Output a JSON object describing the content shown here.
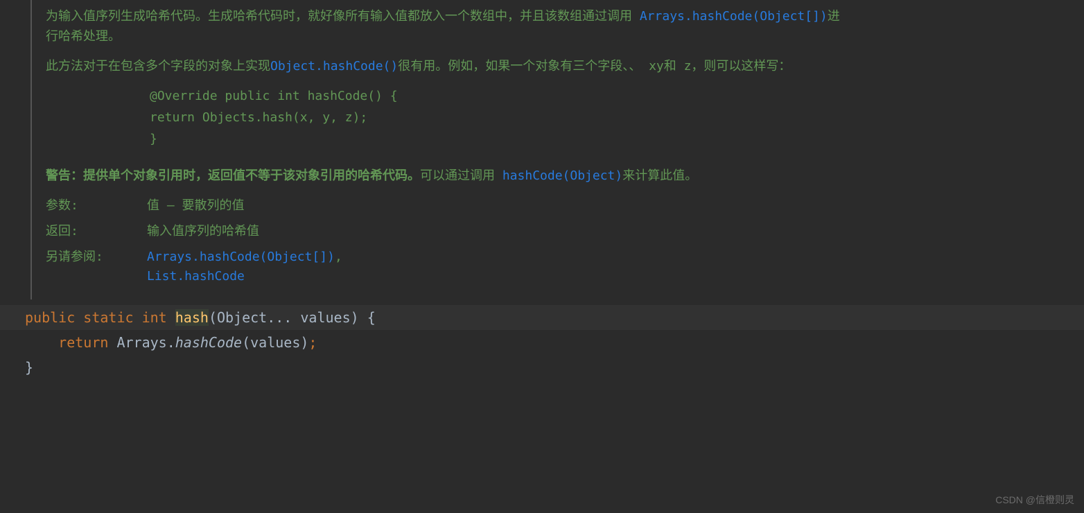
{
  "doc": {
    "para1_a": "为输入值序列生成哈希代码。生成哈希代码时，就好像所有输入值都放入一个数组中，并且该数组通过调用 ",
    "para1_link": "Arrays.hashCode(Object[])",
    "para1_b": "进行哈希处理。",
    "para2_a": "此方法对于在包含多个字段的对象上实现",
    "para2_link": "Object.hashCode()",
    "para2_b": "很有用。例如，如果一个对象有三个字段、、 xy和 z，则可以这样写：",
    "codeblock_l1": "@Override public int hashCode() {",
    "codeblock_l2": "    return Objects.hash(x, y, z);",
    "codeblock_l3": "}",
    "warn_bold": "警告：提供单个对象引用时，返回值不等于该对象引用的哈希代码。",
    "warn_a": "可以通过调用 ",
    "warn_link": "hashCode(Object)",
    "warn_b": "来计算此值。",
    "params_label": "参数:",
    "params_value": "值 – 要散列的值",
    "returns_label": "返回:",
    "returns_value": "输入值序列的哈希值",
    "seealso_label": "另请参阅:",
    "seealso_link1": "Arrays.hashCode(Object[])",
    "seealso_comma": ", ",
    "seealso_link2": "List.hashCode"
  },
  "code": {
    "kw_public": "public",
    "kw_static": "static",
    "kw_int": "int",
    "fn_name": "hash",
    "sig_params": "(Object... values) {",
    "kw_return": "return",
    "call_cls": " Arrays.",
    "call_method": "hashCode",
    "call_args": "(values)",
    "semi": ";",
    "close": "}"
  },
  "watermark": "CSDN @信橙则灵"
}
